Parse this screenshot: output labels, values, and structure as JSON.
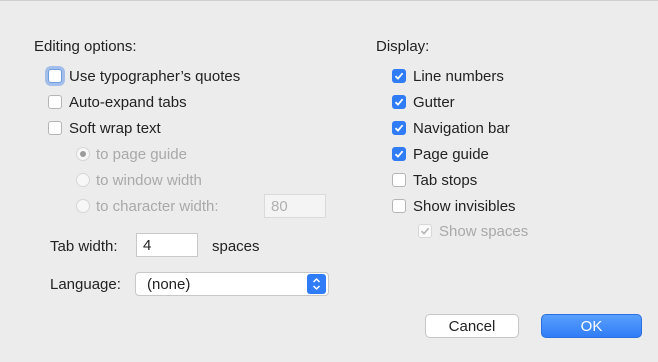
{
  "editing": {
    "title": "Editing options:",
    "use_quotes": {
      "label": "Use typographer’s quotes",
      "checked": false
    },
    "auto_expand": {
      "label": "Auto-expand tabs",
      "checked": false
    },
    "soft_wrap": {
      "label": "Soft wrap text",
      "checked": false
    },
    "wrap_options": [
      {
        "label": "to page guide",
        "selected": true
      },
      {
        "label": "to window width",
        "selected": false
      },
      {
        "label": "to character width:",
        "selected": false
      }
    ],
    "character_width_value": "80",
    "tab_width_label": "Tab width:",
    "tab_width_value": "4",
    "tab_width_unit": "spaces",
    "language_label": "Language:",
    "language_value": "(none)"
  },
  "display": {
    "title": "Display:",
    "items": [
      {
        "label": "Line numbers",
        "checked": true
      },
      {
        "label": "Gutter",
        "checked": true
      },
      {
        "label": "Navigation bar",
        "checked": true
      },
      {
        "label": "Page guide",
        "checked": true
      },
      {
        "label": "Tab stops",
        "checked": false
      },
      {
        "label": "Show invisibles",
        "checked": false
      }
    ],
    "show_spaces": {
      "label": "Show spaces",
      "checked": true
    }
  },
  "buttons": {
    "cancel": "Cancel",
    "ok": "OK"
  },
  "colors": {
    "accent": "#2f7cf6",
    "background": "#ececec"
  }
}
